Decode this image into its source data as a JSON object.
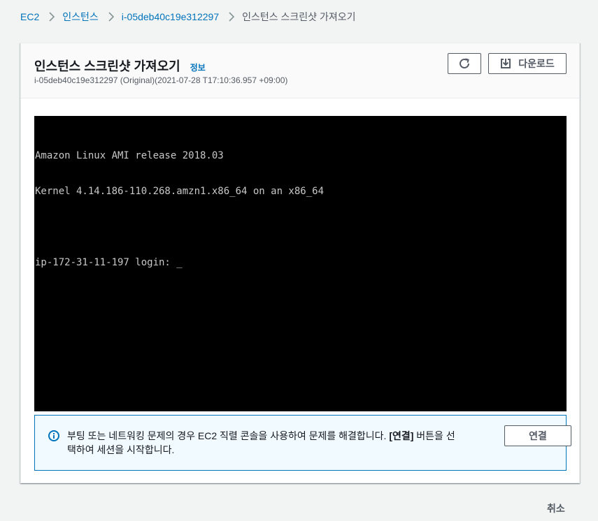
{
  "breadcrumb": {
    "items": [
      {
        "label": "EC2"
      },
      {
        "label": "인스턴스"
      },
      {
        "label": "i-05deb40c19e312297"
      }
    ],
    "current": "인스턴스 스크린샷 가져오기"
  },
  "header": {
    "title": "인스턴스 스크린샷 가져오기",
    "info_label": "정보",
    "subtitle": "i-05deb40c19e312297 (Original)(2021-07-28 T17:10:36.957 +09:00)",
    "refresh_icon": "refresh-icon",
    "download_icon": "download-icon",
    "download_label": "다운로드"
  },
  "terminal": {
    "line1": "Amazon Linux AMI release 2018.03",
    "line2": "Kernel 4.14.186-110.268.amzn1.x86_64 on an x86_64",
    "line3": "",
    "line4": "ip-172-31-11-197 login: _"
  },
  "alert": {
    "icon": "info-icon",
    "text_before": "부팅 또는 네트워킹 문제의 경우 EC2 직렬 콘솔을 사용하여 문제를 해결합니다. ",
    "text_bold": "[연결]",
    "text_after": " 버튼을 선택하여 세션을 시작합니다.",
    "connect_label": "연결"
  },
  "footer": {
    "cancel_label": "취소"
  },
  "colors": {
    "link": "#0073bb",
    "alert_border": "#0073bb",
    "alert_bg": "#f1faff",
    "terminal_bg": "#000000"
  }
}
